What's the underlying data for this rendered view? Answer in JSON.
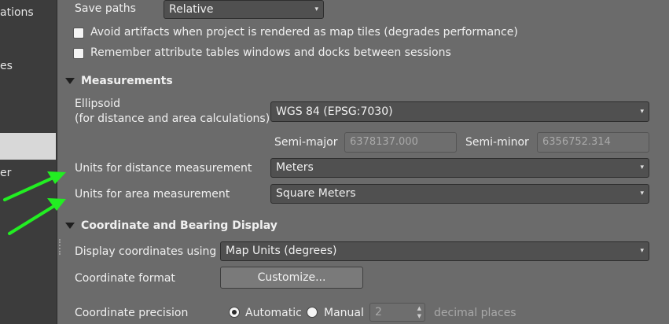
{
  "sidebar": {
    "items": [
      {
        "label": "ations"
      },
      {
        "label": "es"
      },
      {
        "label": ""
      },
      {
        "label": "er"
      }
    ]
  },
  "general": {
    "save_paths_label": "Save paths",
    "save_paths_value": "Relative",
    "avoid_artifacts_label": "Avoid artifacts when project is rendered as map tiles (degrades performance)",
    "avoid_artifacts_checked": false,
    "remember_tables_label": "Remember attribute tables windows and docks between sessions",
    "remember_tables_checked": false
  },
  "measurements": {
    "heading": "Measurements",
    "ellipsoid_label_line1": "Ellipsoid",
    "ellipsoid_label_line2": "(for distance and area calculations)",
    "ellipsoid_value": "WGS 84 (EPSG:7030)",
    "semi_major_label": "Semi-major",
    "semi_major_value": "6378137.000",
    "semi_minor_label": "Semi-minor",
    "semi_minor_value": "6356752.314",
    "distance_units_label": "Units for distance measurement",
    "distance_units_value": "Meters",
    "area_units_label": "Units for area measurement",
    "area_units_value": "Square Meters"
  },
  "coordinate_display": {
    "heading": "Coordinate and Bearing Display",
    "display_using_label": "Display coordinates using",
    "display_using_value": "Map Units (degrees)",
    "format_label": "Coordinate format",
    "customize_button": "Customize...",
    "precision_label": "Coordinate precision",
    "automatic_label": "Automatic",
    "manual_label": "Manual",
    "precision_selected": "Automatic",
    "manual_value": "2",
    "decimal_places_label": "decimal places"
  },
  "colors": {
    "annotation_arrow": "#22ee22",
    "panel_background": "#6b6b6b",
    "sidebar_background": "#3c3c3c"
  },
  "icons": {
    "combo_arrow": "▾",
    "collapse": "triangle-down",
    "spin_up": "▲",
    "spin_down": "▼"
  }
}
